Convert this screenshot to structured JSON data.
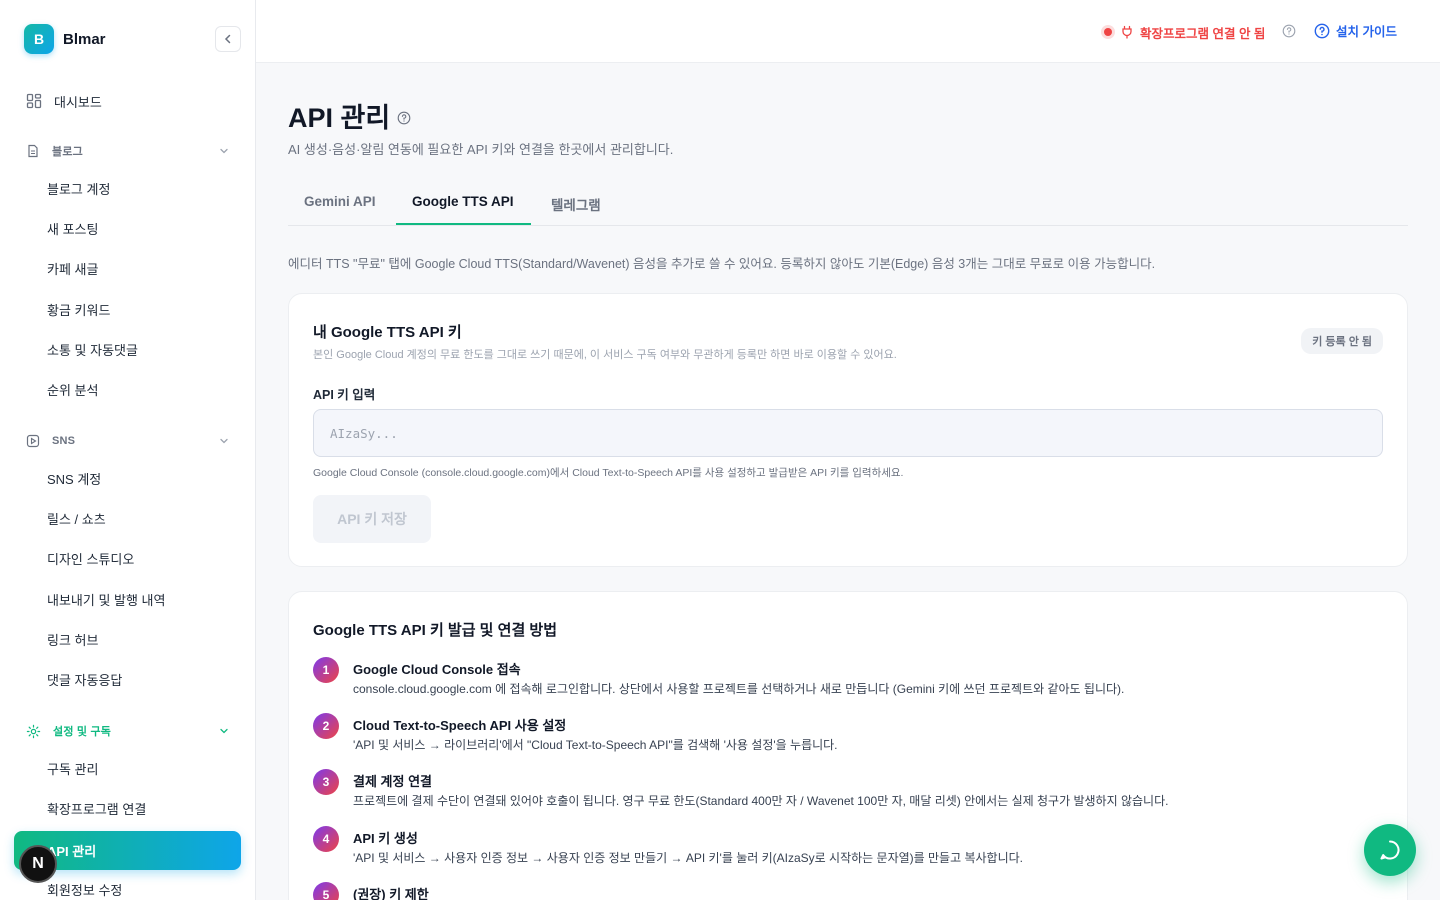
{
  "brand": {
    "logo_letter": "B",
    "name": "Blmar"
  },
  "sidebar": {
    "dashboard": "대시보드",
    "blog": {
      "label": "블로그",
      "items": [
        "블로그 계정",
        "새 포스팅",
        "카페 새글",
        "황금 키워드",
        "소통 및 자동댓글",
        "순위 분석"
      ]
    },
    "sns": {
      "label": "SNS",
      "items": [
        "SNS 계정",
        "릴스 / 쇼츠",
        "디자인 스튜디오",
        "내보내기 및 발행 내역",
        "링크 허브",
        "댓글 자동응답"
      ]
    },
    "settings": {
      "label": "설정 및 구독",
      "items": [
        "구독 관리",
        "확장프로그램 연결",
        "API 관리",
        "회원정보 수정"
      ]
    },
    "avatar_letter": "N",
    "accent": "#10b981"
  },
  "topbar": {
    "ext_status": "확장프로그램 연결 안 됨",
    "guide": "설치 가이드",
    "status_color": "#ef4444"
  },
  "page": {
    "title": "API 관리",
    "description": "AI 생성·음성·알림 연동에 필요한 API 키와 연결을 한곳에서 관리합니다.",
    "tabs": [
      "Gemini API",
      "Google TTS API",
      "텔레그램"
    ],
    "active_tab": "Google TTS API",
    "note": "에디터 TTS \"무료\" 탭에 Google Cloud TTS(Standard/Wavenet) 음성을 추가로 쓸 수 있어요. 등록하지 않아도 기본(Edge) 음성 3개는 그대로 무료로 이용 가능합니다."
  },
  "key_card": {
    "title": "내 Google TTS API 키",
    "subtitle": "본인 Google Cloud 계정의 무료 한도를 그대로 쓰기 때문에, 이 서비스 구독 여부와 무관하게 등록만 하면 바로 이용할 수 있어요.",
    "badge": "키 등록 안 됨",
    "input_label": "API 키 입력",
    "input_placeholder": "AIzaSy...",
    "input_value": "",
    "help": "Google Cloud Console (console.cloud.google.com)에서 Cloud Text-to-Speech API를 사용 설정하고 발급받은 API 키를 입력하세요.",
    "save_label": "API 키 저장"
  },
  "guide_card": {
    "title": "Google TTS API 키 발급 및 연결 방법",
    "steps": [
      {
        "num": "1",
        "title": "Google Cloud Console 접속",
        "desc": "console.cloud.google.com 에 접속해 로그인합니다. 상단에서 사용할 프로젝트를 선택하거나 새로 만듭니다 (Gemini 키에 쓰던 프로젝트와 같아도 됩니다)."
      },
      {
        "num": "2",
        "title": "Cloud Text-to-Speech API 사용 설정",
        "desc": "'API 및 서비스 → 라이브러리'에서 \"Cloud Text-to-Speech API\"를 검색해 '사용 설정'을 누릅니다."
      },
      {
        "num": "3",
        "title": "결제 계정 연결",
        "desc": "프로젝트에 결제 수단이 연결돼 있어야 호출이 됩니다. 영구 무료 한도(Standard 400만 자 / Wavenet 100만 자, 매달 리셋) 안에서는 실제 청구가 발생하지 않습니다."
      },
      {
        "num": "4",
        "title": "API 키 생성",
        "desc": "'API 및 서비스 → 사용자 인증 정보 → 사용자 인증 정보 만들기 → API 키'를 눌러 키(AIzaSy로 시작하는 문자열)를 만들고 복사합니다."
      },
      {
        "num": "5",
        "title": "(권장) 키 제한",
        "desc": ""
      }
    ]
  }
}
